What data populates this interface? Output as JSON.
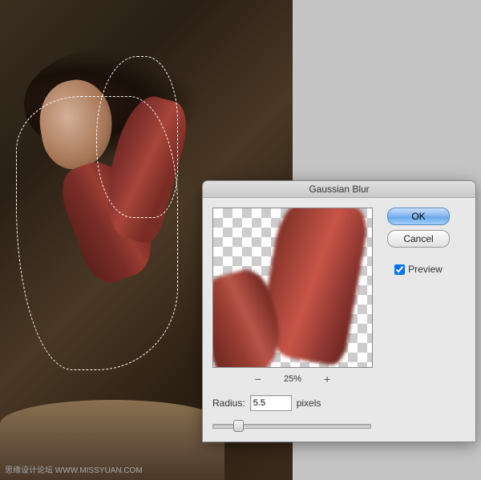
{
  "canvas": {
    "watermark": "思缘设计论坛  WWW.MISSYUAN.COM"
  },
  "dialog": {
    "title": "Gaussian Blur",
    "ok_label": "OK",
    "cancel_label": "Cancel",
    "preview_label": "Preview",
    "preview_checked": true,
    "zoom": {
      "minus": "−",
      "value": "25%",
      "plus": "+"
    },
    "radius_label": "Radius:",
    "radius_value": "5.5",
    "radius_unit": "pixels"
  }
}
